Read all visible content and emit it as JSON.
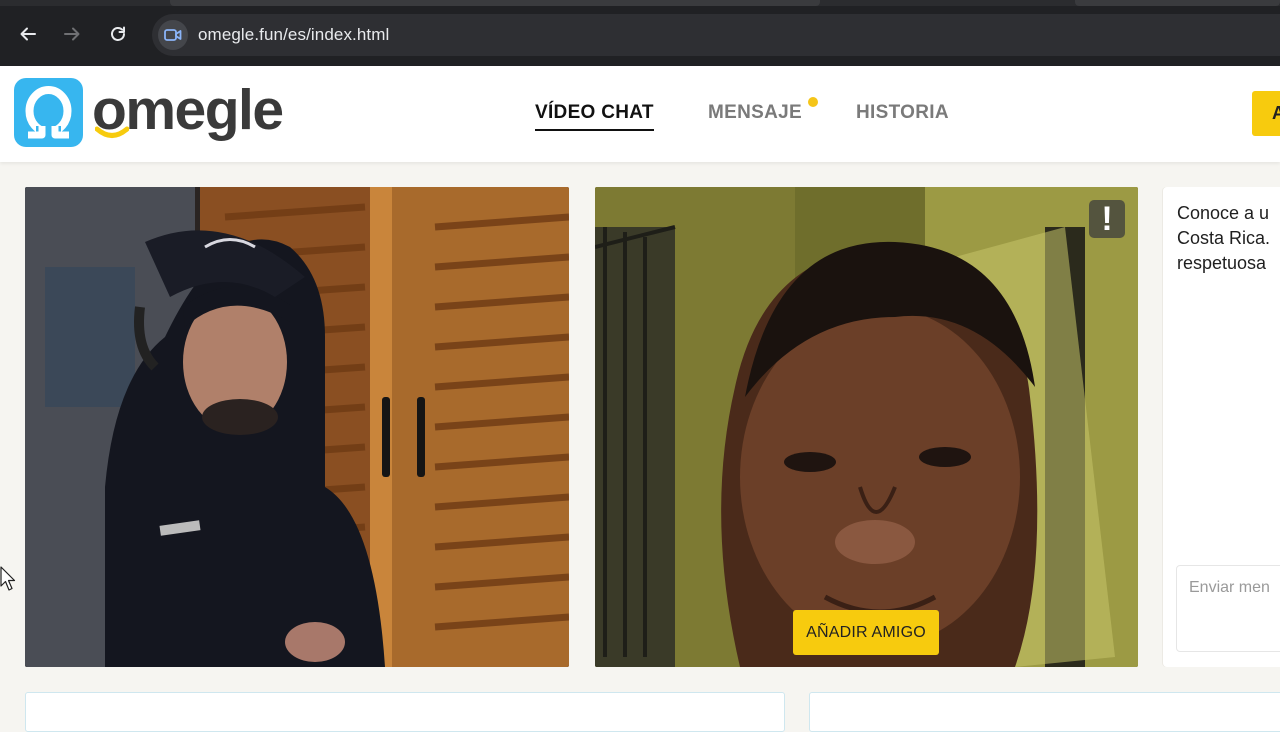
{
  "browser": {
    "url": "omegle.fun/es/index.html",
    "icons": [
      "back-arrow-icon",
      "forward-arrow-icon",
      "reload-icon",
      "video-camera-site-icon"
    ]
  },
  "header": {
    "logo_text": "omegle",
    "nav": [
      {
        "label": "VÍDEO CHAT",
        "active": true
      },
      {
        "label": "MENSAJE",
        "active": false,
        "has_notification": true
      },
      {
        "label": "HISTORIA",
        "active": false
      }
    ],
    "cta_label": "A"
  },
  "video": {
    "report_label": "!",
    "add_friend_label": "AÑADIR AMIGO"
  },
  "chat": {
    "message_lines": [
      "Conoce a u",
      "Costa Rica.",
      "respetuosa"
    ],
    "input_placeholder": "Enviar men"
  },
  "colors": {
    "accent_yellow": "#f7cb0e",
    "logo_blue": "#37b6ef",
    "chrome_dark": "#202124"
  }
}
